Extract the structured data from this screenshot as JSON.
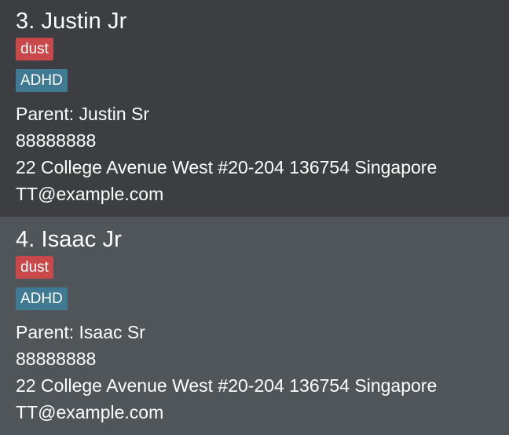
{
  "contacts": [
    {
      "index": "3.",
      "name": "3. Justin Jr",
      "allergy_tag": "dust",
      "condition_tag": "ADHD",
      "parent": "Parent: Justin Sr",
      "phone": "88888888",
      "address": "22 College Avenue West #20-204 136754 Singapore",
      "email": "TT@example.com"
    },
    {
      "index": "4.",
      "name": "4. Isaac Jr",
      "allergy_tag": "dust",
      "condition_tag": "ADHD",
      "parent": "Parent: Isaac Sr",
      "phone": "88888888",
      "address": "22 College Avenue West #20-204 136754 Singapore",
      "email": "TT@example.com"
    }
  ],
  "colors": {
    "card_dark_bg": "#3c3e41",
    "card_light_bg": "#50555a",
    "allergy_tag_bg": "#c9484a",
    "condition_tag_bg": "#3f7a92",
    "text": "#ffffff"
  }
}
